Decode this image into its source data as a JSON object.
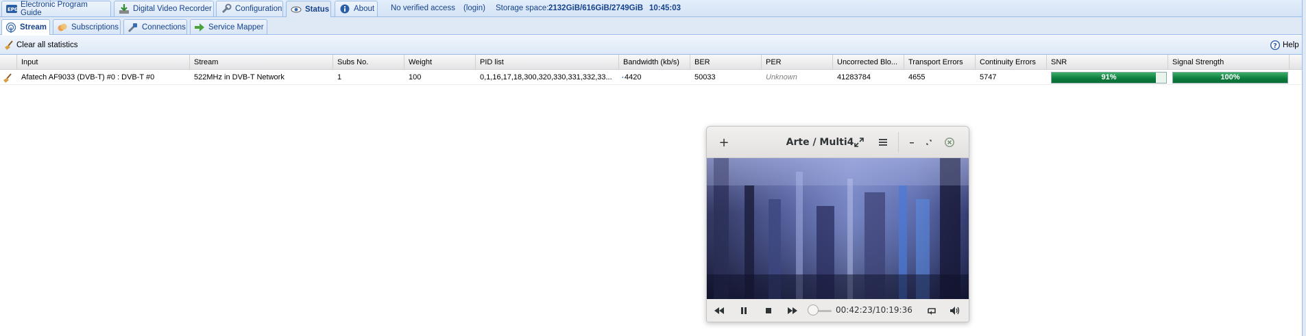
{
  "top_tabs": [
    {
      "label": "Electronic Program Guide"
    },
    {
      "label": "Digital Video Recorder"
    },
    {
      "label": "Configuration"
    },
    {
      "label": "Status"
    },
    {
      "label": "About"
    }
  ],
  "top_info": {
    "access": "No verified access",
    "login": "(login)",
    "storage_label": "Storage space:",
    "storage_value": "2132GiB/616GiB/2749GiB",
    "time": "10:45:03"
  },
  "sub_tabs": [
    {
      "label": "Stream"
    },
    {
      "label": "Subscriptions"
    },
    {
      "label": "Connections"
    },
    {
      "label": "Service Mapper"
    }
  ],
  "toolbar": {
    "clear_label": "Clear all statistics",
    "help_label": "Help"
  },
  "grid": {
    "columns": [
      "Input",
      "Stream",
      "Subs No.",
      "Weight",
      "PID list",
      "Bandwidth (kb/s)",
      "BER",
      "PER",
      "Uncorrected Blo...",
      "Transport Errors",
      "Continuity Errors",
      "SNR",
      "Signal Strength"
    ],
    "row": {
      "input": "Afatech AF9033 (DVB-T) #0 : DVB-T #0",
      "stream": "522MHz in DVB-T Network",
      "subs": "1",
      "weight": "100",
      "pids": "0,1,16,17,18,300,320,330,331,332,33...",
      "bandwidth": "4420",
      "ber": "50033",
      "per": "Unknown",
      "uncorrected": "41283784",
      "transport": "4655",
      "continuity": "5747",
      "snr_label": "91%",
      "snr_level": 0.91,
      "signal_label": "100%",
      "signal_level": 1.0
    }
  },
  "player": {
    "title": "Arte / Multi4",
    "time": "00:42:23/10:19:36",
    "position": 0.07
  },
  "colors": {
    "accent": "#15428b",
    "bar_green": "#0a7a3a",
    "header_bg": "#dfe9f6"
  }
}
